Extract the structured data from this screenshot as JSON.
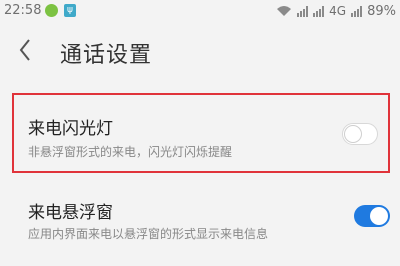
{
  "status_bar": {
    "time": "22:58",
    "network": "4G",
    "battery": "89%",
    "icons": [
      "app-icon",
      "usb-icon",
      "wifi-icon",
      "signal-icon"
    ]
  },
  "header": {
    "back_icon": "chevron-left-icon",
    "title": "通话设置"
  },
  "settings": [
    {
      "label": "来电闪光灯",
      "description": "非悬浮窗形式的来电，闪光灯闪烁提醒",
      "toggle": "off"
    },
    {
      "label": "来电悬浮窗",
      "description": "应用内界面来电以悬浮窗的形式显示来电信息",
      "toggle": "on"
    }
  ],
  "colors": {
    "highlight_border": "#e0333a",
    "toggle_on": "#1f7ae0",
    "background": "#f3f3f3"
  }
}
